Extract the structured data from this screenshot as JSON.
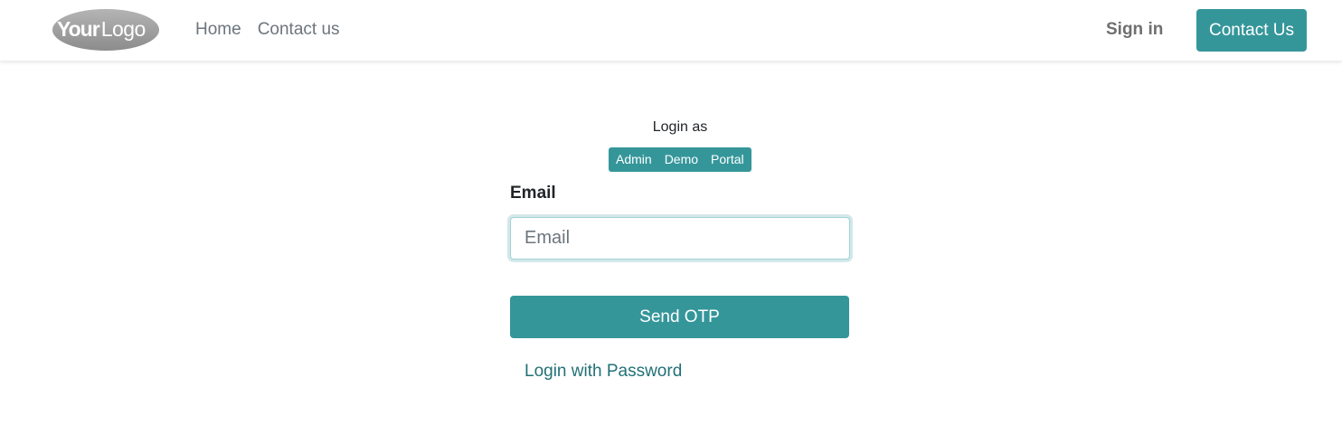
{
  "header": {
    "logo_text": "YourLogo",
    "nav": [
      {
        "label": "Home"
      },
      {
        "label": "Contact us"
      }
    ],
    "sign_in_label": "Sign in",
    "contact_button_label": "Contact Us"
  },
  "login": {
    "login_as_label": "Login as",
    "login_as_options": [
      {
        "label": "Admin"
      },
      {
        "label": "Demo"
      },
      {
        "label": "Portal"
      }
    ],
    "email_label": "Email",
    "email_placeholder": "Email",
    "email_value": "",
    "send_otp_label": "Send OTP",
    "password_link_label": "Login with Password"
  },
  "colors": {
    "accent": "#35969a",
    "link": "#227177",
    "nav_text": "#6c757d",
    "logo_gray": "#8c8c8c"
  }
}
